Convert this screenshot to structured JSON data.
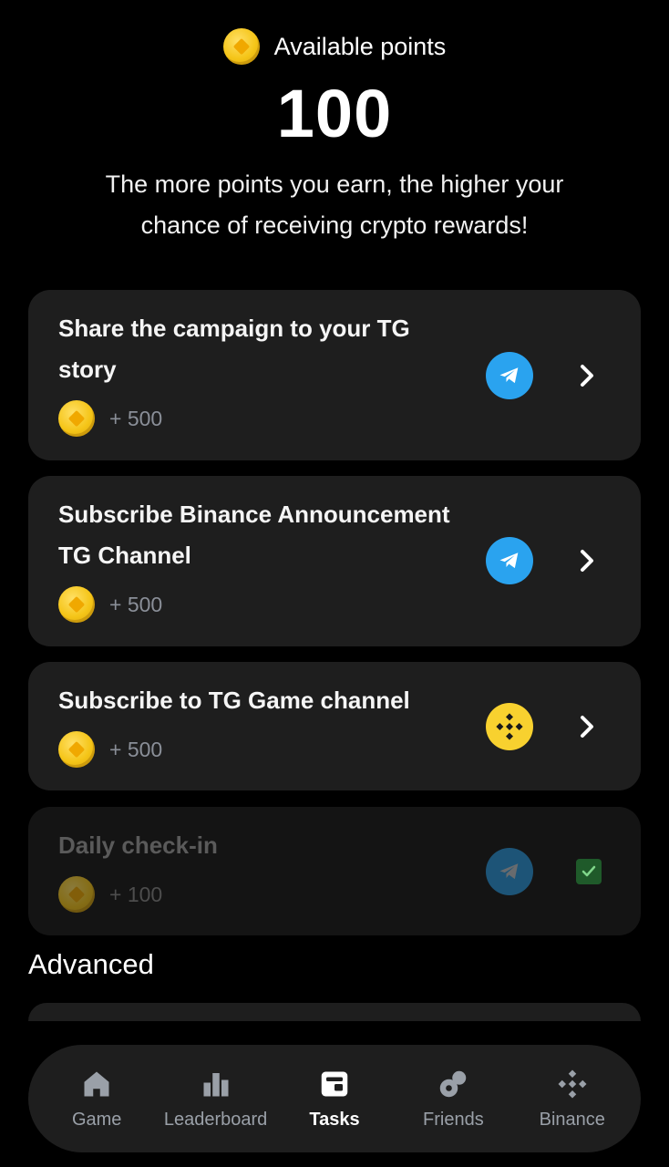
{
  "header": {
    "points_label": "Available points",
    "points_value": "100",
    "description": "The more points you earn, the higher your chance of receiving crypto rewards!"
  },
  "tasks": [
    {
      "title": "Share the campaign to your TG story",
      "reward": "+ 500",
      "icon": "telegram-icon",
      "status": "open"
    },
    {
      "title": "Subscribe Binance Announcement TG Channel",
      "reward": "+ 500",
      "icon": "telegram-icon",
      "status": "open"
    },
    {
      "title": "Subscribe to TG Game channel",
      "reward": "+ 500",
      "icon": "binance-icon",
      "status": "open"
    },
    {
      "title": "Daily check-in",
      "reward": "+ 100",
      "icon": "telegram-icon",
      "status": "completed"
    }
  ],
  "sections": {
    "advanced_title": "Advanced"
  },
  "nav": {
    "items": [
      {
        "label": "Game",
        "icon": "home-icon"
      },
      {
        "label": "Leaderboard",
        "icon": "bar-chart-icon"
      },
      {
        "label": "Tasks",
        "icon": "tasks-icon",
        "active": true
      },
      {
        "label": "Friends",
        "icon": "friends-icon"
      },
      {
        "label": "Binance",
        "icon": "binance-icon"
      }
    ]
  },
  "colors": {
    "background": "#000000",
    "card": "#1e1e1e",
    "telegram": "#2aa3ef",
    "binance_yellow": "#f8d12f",
    "coin": "#f5c518",
    "muted_text": "#8a8f98"
  }
}
